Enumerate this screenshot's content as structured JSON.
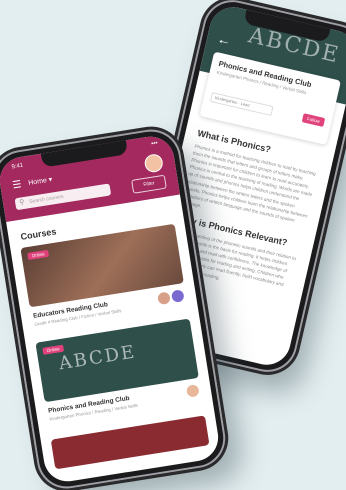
{
  "back_screen": {
    "hero_text": "ABCDE",
    "course_title": "Phonics and Reading Club",
    "course_meta": "Kindergarten Phonics / Reading / Verbal Skills",
    "course_pill": "Kindergarten · Lead",
    "follow_label": "Follow",
    "sections": [
      {
        "heading": "What is Phonics?",
        "body": "Phonics is a method for teaching children to read by teaching them the sounds that letters and groups of letters make. Phonics is important for children to learn to read accurately. Phonics is central to the teaching of reading. Words are made up of sounds and phonics helps children understand the relationship between the written letters and the spoken sounds. Phonics helps children learn the relationship between the letters of written language and the sounds of spoken language."
      },
      {
        "heading": "Why is Phonics Relevant?",
        "body": "An understanding of the phonetic sounds and their relation to the written words is the basis for reading. It helps children decode, spell and read with confidence. The knowledge of phonics is the basis for reading and writing. Children who learn phonics early can read fluently, build vocabulary and develop a love for reading."
      }
    ]
  },
  "front_screen": {
    "time": "9:41",
    "signal": "▪▪▪",
    "home_label": "Home ▾",
    "search_placeholder": "Search courses",
    "filter_label": "Filter",
    "section_title": "Courses",
    "cards": [
      {
        "tag": "Online",
        "title": "Educators Reading Club",
        "meta": "Grade 4 Reading Club / Fiction / Verbal Skills"
      },
      {
        "tag": "Online",
        "hero_text": "ABCDE",
        "title": "Phonics and Reading Club",
        "meta": "Kindergarten Phonics / Reading / Verbal Skills"
      }
    ]
  },
  "colors": {
    "brand": "#a3295e",
    "accent": "#e0427b",
    "chalkboard": "#2f4f4b",
    "background": "#e3eef0"
  }
}
